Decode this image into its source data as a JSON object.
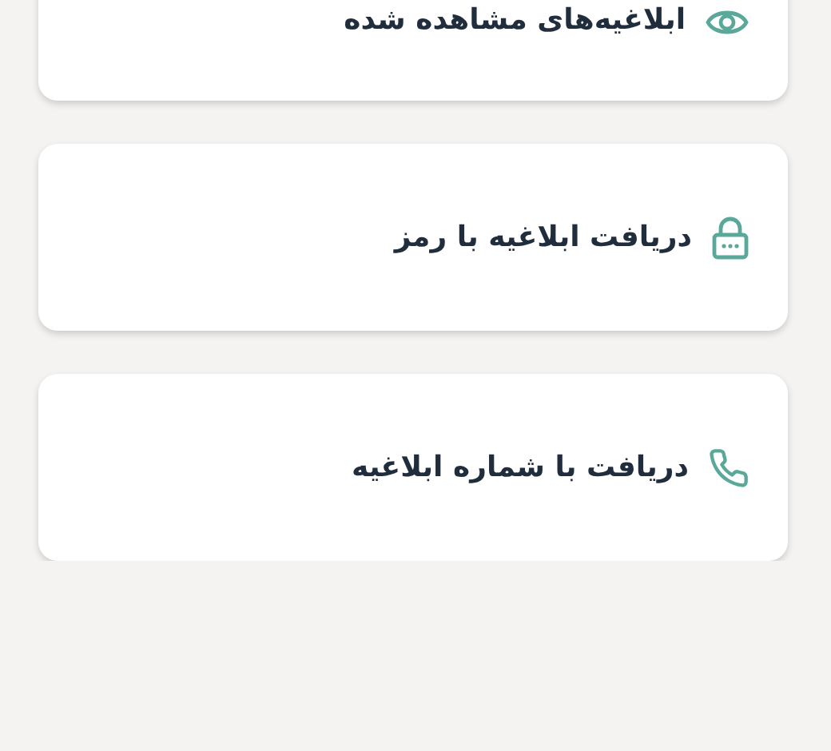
{
  "items": [
    {
      "kind": "eye",
      "label": "ابلاغیه‌های مشاهده شده"
    },
    {
      "kind": "lock",
      "label": "دریافت ابلاغیه با رمز"
    },
    {
      "kind": "phone",
      "label": "دریافت با شماره ابلاغیه"
    }
  ]
}
